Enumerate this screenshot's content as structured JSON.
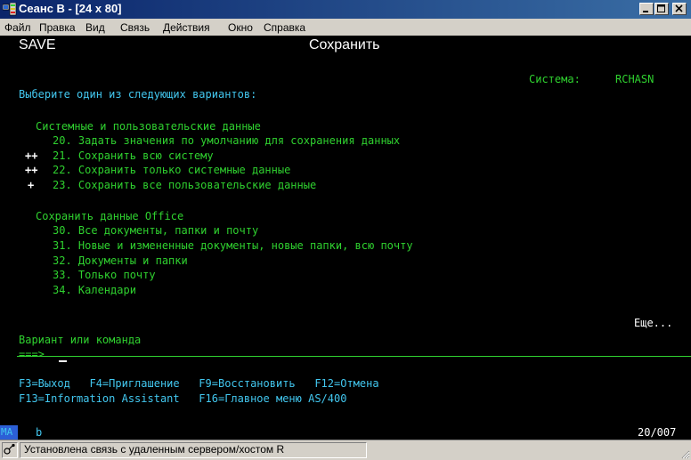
{
  "window": {
    "title": "Сеанс B - [24 x 80]"
  },
  "menu": [
    "Файл",
    "Правка",
    "Вид",
    "Связь",
    "Действия",
    "Окно",
    "Справка"
  ],
  "screen": {
    "panel_id": "SAVE",
    "panel_title": "Сохранить",
    "system_label": "Система:",
    "system_name": "RCHASN",
    "prompt": "Выберите один из следующих вариантов:",
    "group1_title": "Системные и пользовательские данные",
    "group1": [
      {
        "marker": "",
        "text": "20. Задать значения по умолчанию для сохранения данных"
      },
      {
        "marker": "++",
        "text": "21. Сохранить всю систему"
      },
      {
        "marker": "++",
        "text": "22. Сохранить только системные данные"
      },
      {
        "marker": "+",
        "text": "23. Сохранить все пользовательские данные"
      }
    ],
    "group2_title": "Сохранить данные Office",
    "group2": [
      "30. Все документы, папки и почту",
      "31. Новые и измененные документы, новые папки, всю почту",
      "32. Документы и папки",
      "33. Только почту",
      "34. Календари"
    ],
    "more": "Еще...",
    "input_label": "Вариант или команда",
    "input_arrow": "===>",
    "input_value": "",
    "fkeys_line1": "F3=Выход   F4=Приглашение   F9=Восстановить   F12=Отмена",
    "fkeys_line2": "F13=Information Assistant   F16=Главное меню AS/400"
  },
  "oia": {
    "mode": "MA",
    "indicator": "b",
    "cursor_pos": "20/007"
  },
  "statusbar": {
    "message": "Установлена связь с удаленным сервером/хостом R"
  },
  "colors": {
    "green": "#2fd12f",
    "cyan": "#42c7ef",
    "white": "#ffffff",
    "titlebar": "#0a246a"
  }
}
